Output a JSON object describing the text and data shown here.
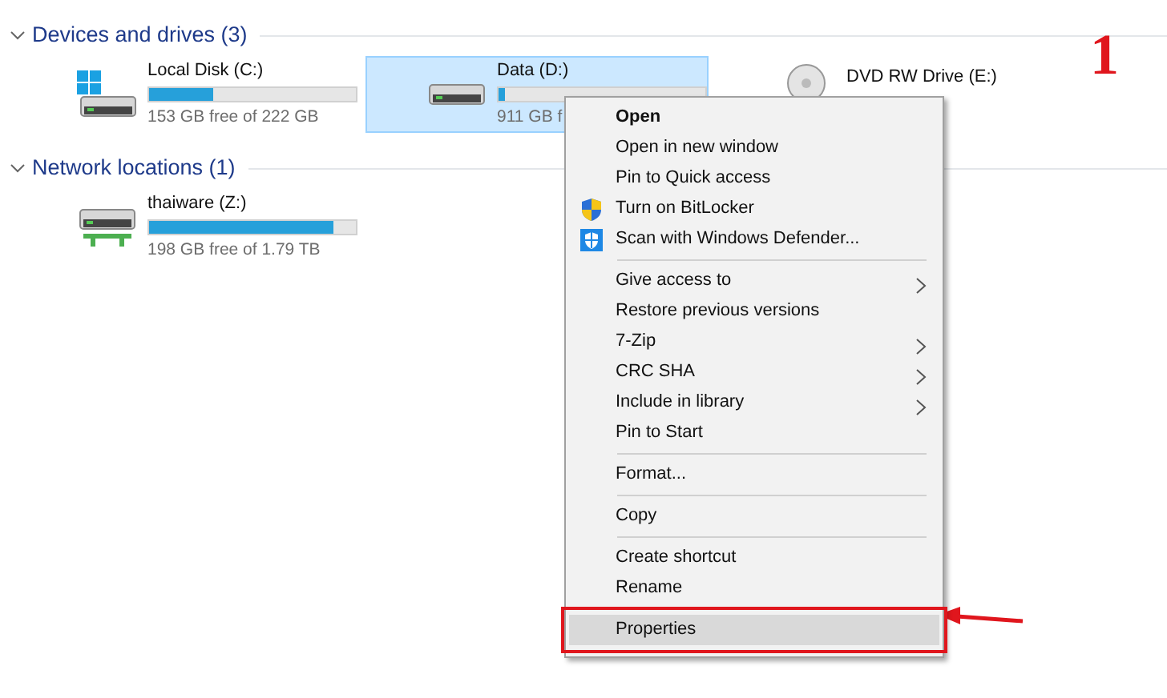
{
  "groups": [
    {
      "title": "Devices and drives (3)",
      "expanded": true,
      "drives": [
        {
          "name": "Local Disk (C:)",
          "kind": "system",
          "level": 0.31,
          "free": "153 GB free of 222 GB",
          "selected": false
        },
        {
          "name": "Data (D:)",
          "kind": "disk",
          "level": 0.03,
          "free": "911 GB f",
          "selected": true
        },
        {
          "name": "DVD RW Drive (E:)",
          "kind": "optical",
          "selected": false
        }
      ]
    },
    {
      "title": "Network locations (1)",
      "expanded": true,
      "drives": [
        {
          "name": "thaiware (Z:)",
          "kind": "network",
          "level": 0.89,
          "free": "198 GB free of 1.79 TB",
          "selected": false
        }
      ]
    }
  ],
  "context_menu": [
    {
      "kind": "item",
      "label": "Open",
      "default": true
    },
    {
      "kind": "item",
      "label": "Open in new window"
    },
    {
      "kind": "item",
      "label": "Pin to Quick access"
    },
    {
      "kind": "bitlocker",
      "label": "Turn on BitLocker"
    },
    {
      "kind": "defender",
      "label": "Scan with Windows Defender..."
    },
    {
      "kind": "separator"
    },
    {
      "kind": "item",
      "label": "Give access to",
      "submenu": true
    },
    {
      "kind": "item",
      "label": "Restore previous versions"
    },
    {
      "kind": "item",
      "label": "7-Zip",
      "submenu": true
    },
    {
      "kind": "item",
      "label": "CRC SHA",
      "submenu": true
    },
    {
      "kind": "item",
      "label": "Include in library",
      "submenu": true
    },
    {
      "kind": "item",
      "label": "Pin to Start"
    },
    {
      "kind": "separator"
    },
    {
      "kind": "item",
      "label": "Format..."
    },
    {
      "kind": "separator"
    },
    {
      "kind": "item",
      "label": "Copy"
    },
    {
      "kind": "separator"
    },
    {
      "kind": "item",
      "label": "Create shortcut"
    },
    {
      "kind": "item",
      "label": "Rename"
    },
    {
      "kind": "item",
      "label": "Properties",
      "highlighted": true,
      "callout": true
    }
  ],
  "annotation": {
    "label": "1"
  }
}
